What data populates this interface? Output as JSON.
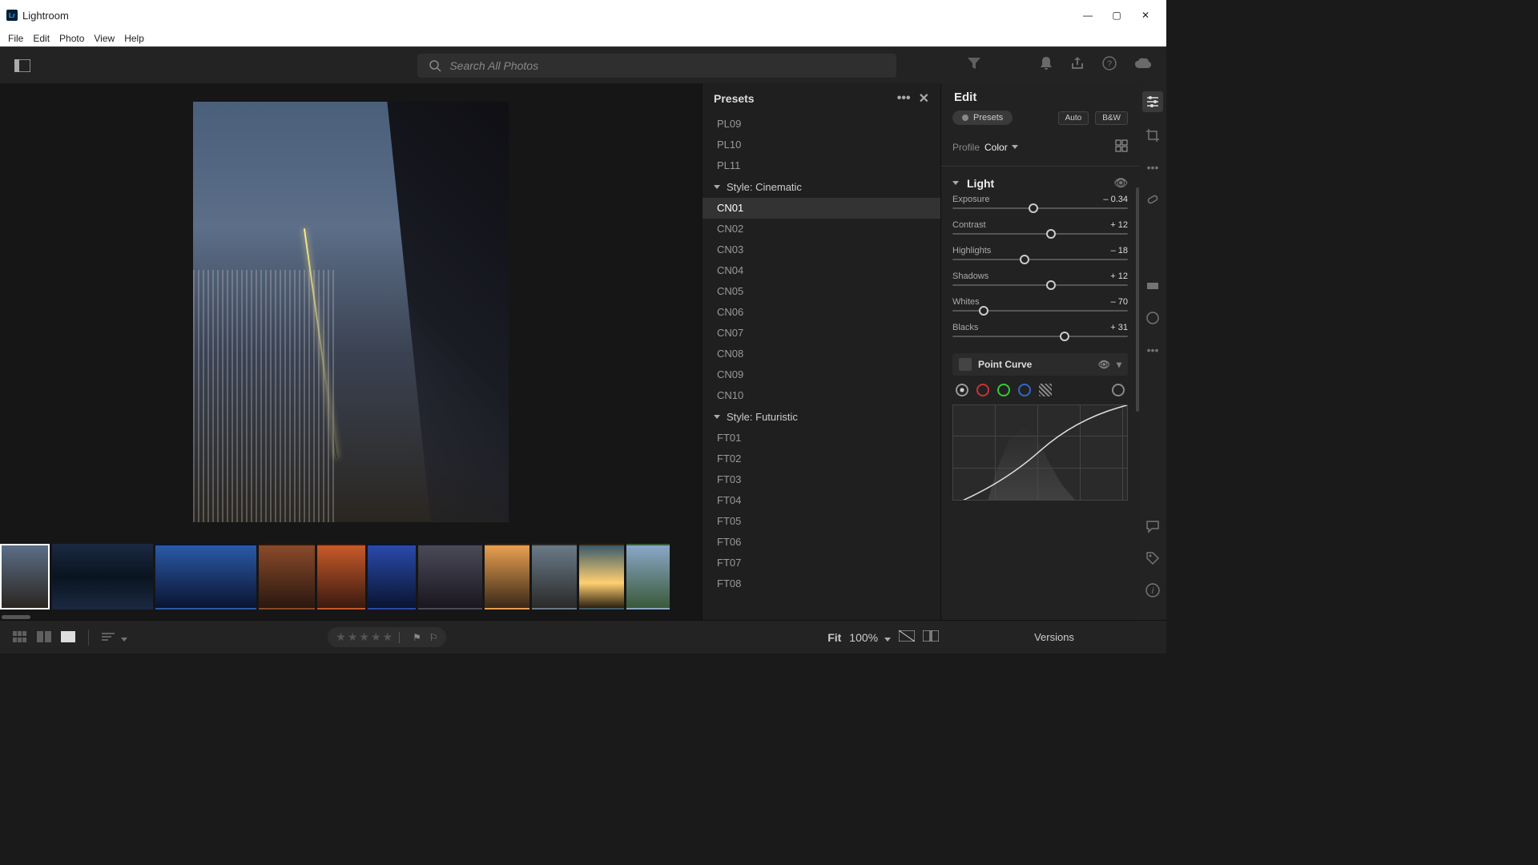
{
  "app": {
    "title": "Lightroom",
    "logo_text": "Lr"
  },
  "window_controls": {
    "minimize": "—",
    "maximize": "▢",
    "close": "✕"
  },
  "menubar": [
    "File",
    "Edit",
    "Photo",
    "View",
    "Help"
  ],
  "search": {
    "placeholder": "Search All Photos"
  },
  "presets_panel": {
    "title": "Presets",
    "top_items": [
      "PL09",
      "PL10",
      "PL11"
    ],
    "group1": {
      "label": "Style: Cinematic",
      "items": [
        "CN01",
        "CN02",
        "CN03",
        "CN04",
        "CN05",
        "CN06",
        "CN07",
        "CN08",
        "CN09",
        "CN10"
      ],
      "selected": "CN01"
    },
    "group2": {
      "label": "Style: Futuristic",
      "items": [
        "FT01",
        "FT02",
        "FT03",
        "FT04",
        "FT05",
        "FT06",
        "FT07",
        "FT08"
      ]
    }
  },
  "edit_panel": {
    "title": "Edit",
    "presets_btn": "Presets",
    "auto_btn": "Auto",
    "bw_btn": "B&W",
    "profile_label": "Profile",
    "profile_value": "Color",
    "light_section": "Light",
    "sliders": {
      "exposure": {
        "label": "Exposure",
        "value": "– 0.34",
        "pos": 46
      },
      "contrast": {
        "label": "Contrast",
        "value": "+ 12",
        "pos": 56
      },
      "highlights": {
        "label": "Highlights",
        "value": "– 18",
        "pos": 41
      },
      "shadows": {
        "label": "Shadows",
        "value": "+ 12",
        "pos": 56
      },
      "whites": {
        "label": "Whites",
        "value": "– 70",
        "pos": 18
      },
      "blacks": {
        "label": "Blacks",
        "value": "+ 31",
        "pos": 64
      }
    },
    "point_curve": "Point Curve",
    "versions": "Versions"
  },
  "bottombar": {
    "fit": "Fit",
    "zoom": "100%"
  },
  "thumbs_count": 11
}
